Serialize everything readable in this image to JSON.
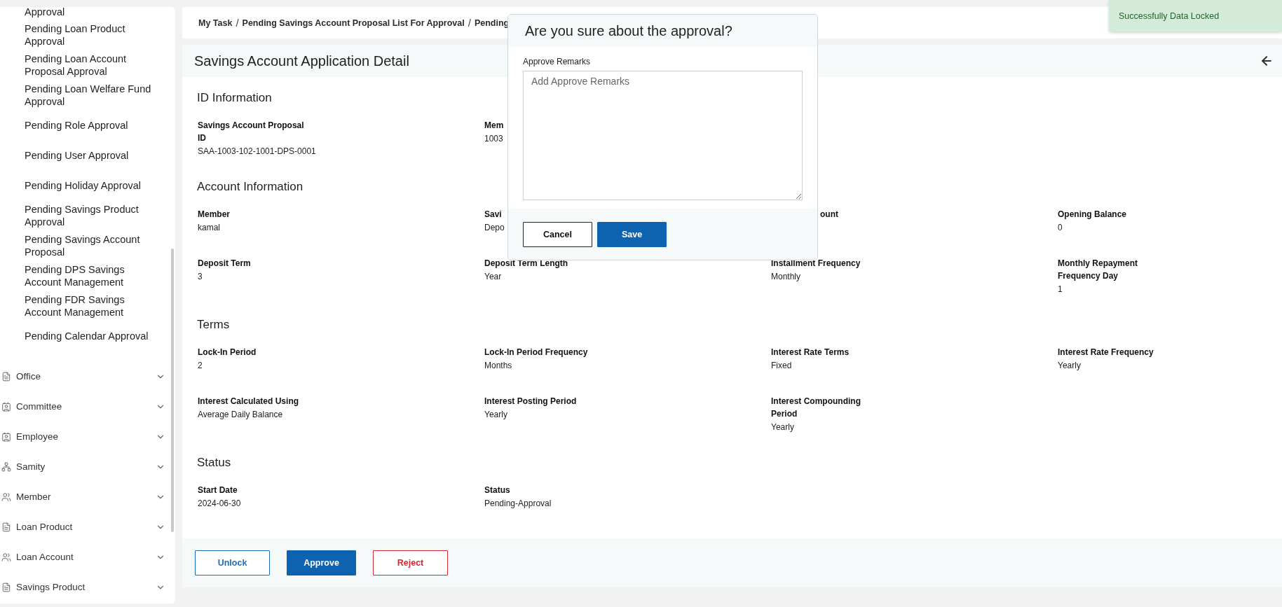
{
  "sidebar": {
    "cut_item": "Approval",
    "pending_items": [
      {
        "label": "Pending Loan Product Approval"
      },
      {
        "label": "Pending Loan Account Proposal Approval"
      },
      {
        "label": "Pending Loan Welfare Fund Approval"
      },
      {
        "label": "Pending Role Approval"
      },
      {
        "label": "Pending User Approval"
      },
      {
        "label": "Pending Holiday Approval"
      },
      {
        "label": "Pending Savings Product Approval"
      },
      {
        "label": "Pending Savings Account Proposal"
      },
      {
        "label": "Pending DPS Savings Account Management"
      },
      {
        "label": "Pending FDR Savings Account Management"
      },
      {
        "label": "Pending Calendar Approval"
      }
    ],
    "groups": [
      {
        "label": "Office",
        "kind": "document",
        "expanded": false
      },
      {
        "label": "Committee",
        "kind": "card",
        "expanded": false
      },
      {
        "label": "Employee",
        "kind": "card",
        "expanded": false
      },
      {
        "label": "Samity",
        "kind": "network",
        "expanded": false
      },
      {
        "label": "Member",
        "kind": "people",
        "expanded": false
      },
      {
        "label": "Loan Product",
        "kind": "document",
        "expanded": false
      },
      {
        "label": "Loan Account",
        "kind": "people",
        "expanded": false
      },
      {
        "label": "Savings Product",
        "kind": "document",
        "expanded": false
      }
    ]
  },
  "breadcrumb": {
    "separator": "/",
    "items": [
      "My Task",
      "Pending Savings Account Proposal List For Approval",
      "Pending"
    ]
  },
  "page_title": "Savings Account Application Detail",
  "sections": [
    {
      "title": "ID Information",
      "fields": [
        {
          "label": "Savings Account Proposal ID",
          "value": "SAA-1003-102-1001-DPS-0001",
          "kind": "full"
        },
        {
          "label": "Mem",
          "value": "1003",
          "kind": "full"
        }
      ]
    },
    {
      "title": "Account Information",
      "fields": [
        {
          "label": "Member",
          "value": "kamal",
          "kind": "full"
        },
        {
          "label": "Savi",
          "value": "Depo",
          "kind": "full"
        },
        {
          "label": "ount",
          "kind": "cut-left"
        },
        {
          "label": "Opening Balance",
          "value": "0",
          "kind": "full"
        },
        {
          "label": "Deposit Term",
          "value": "3",
          "kind": "full"
        },
        {
          "label": "Deposit Term Length",
          "value": "Year",
          "kind": "full"
        },
        {
          "label": "Installment Frequency",
          "value": "Monthly",
          "kind": "full"
        },
        {
          "label": "Monthly Repayment Frequency Day",
          "value": "1",
          "kind": "full"
        }
      ]
    },
    {
      "title": "Terms",
      "fields": [
        {
          "label": "Lock-In Period",
          "value": "2",
          "kind": "full"
        },
        {
          "label": "Lock-In Period Frequency",
          "value": "Months",
          "kind": "full"
        },
        {
          "label": "Interest Rate Terms",
          "value": "Fixed",
          "kind": "full"
        },
        {
          "label": "Interest Rate Frequency",
          "value": "Yearly",
          "kind": "full"
        },
        {
          "label": "Interest Calculated Using",
          "value": "Average Daily Balance",
          "kind": "full"
        },
        {
          "label": "Interest Posting Period",
          "value": "Yearly",
          "kind": "full"
        },
        {
          "label": "Interest Compounding Period",
          "value": "Yearly",
          "kind": "full"
        }
      ]
    },
    {
      "title": "Status",
      "fields": [
        {
          "label": "Start Date",
          "value": "2024-06-30",
          "kind": "full"
        },
        {
          "label": "Status",
          "value": "Pending-Approval",
          "kind": "full"
        }
      ]
    }
  ],
  "actions": [
    {
      "label": "Unlock",
      "kind": "outline"
    },
    {
      "label": "Approve",
      "kind": "primary"
    },
    {
      "label": "Reject",
      "kind": "danger"
    }
  ],
  "modal": {
    "title": "Are you sure about the approval?",
    "field_label": "Approve Remarks",
    "placeholder": "Add Approve Remarks",
    "buttons": [
      {
        "label": "Cancel",
        "kind": "secondary"
      },
      {
        "label": "Save",
        "kind": "primary"
      }
    ]
  },
  "toast": {
    "message": "Successfully Data Locked"
  }
}
